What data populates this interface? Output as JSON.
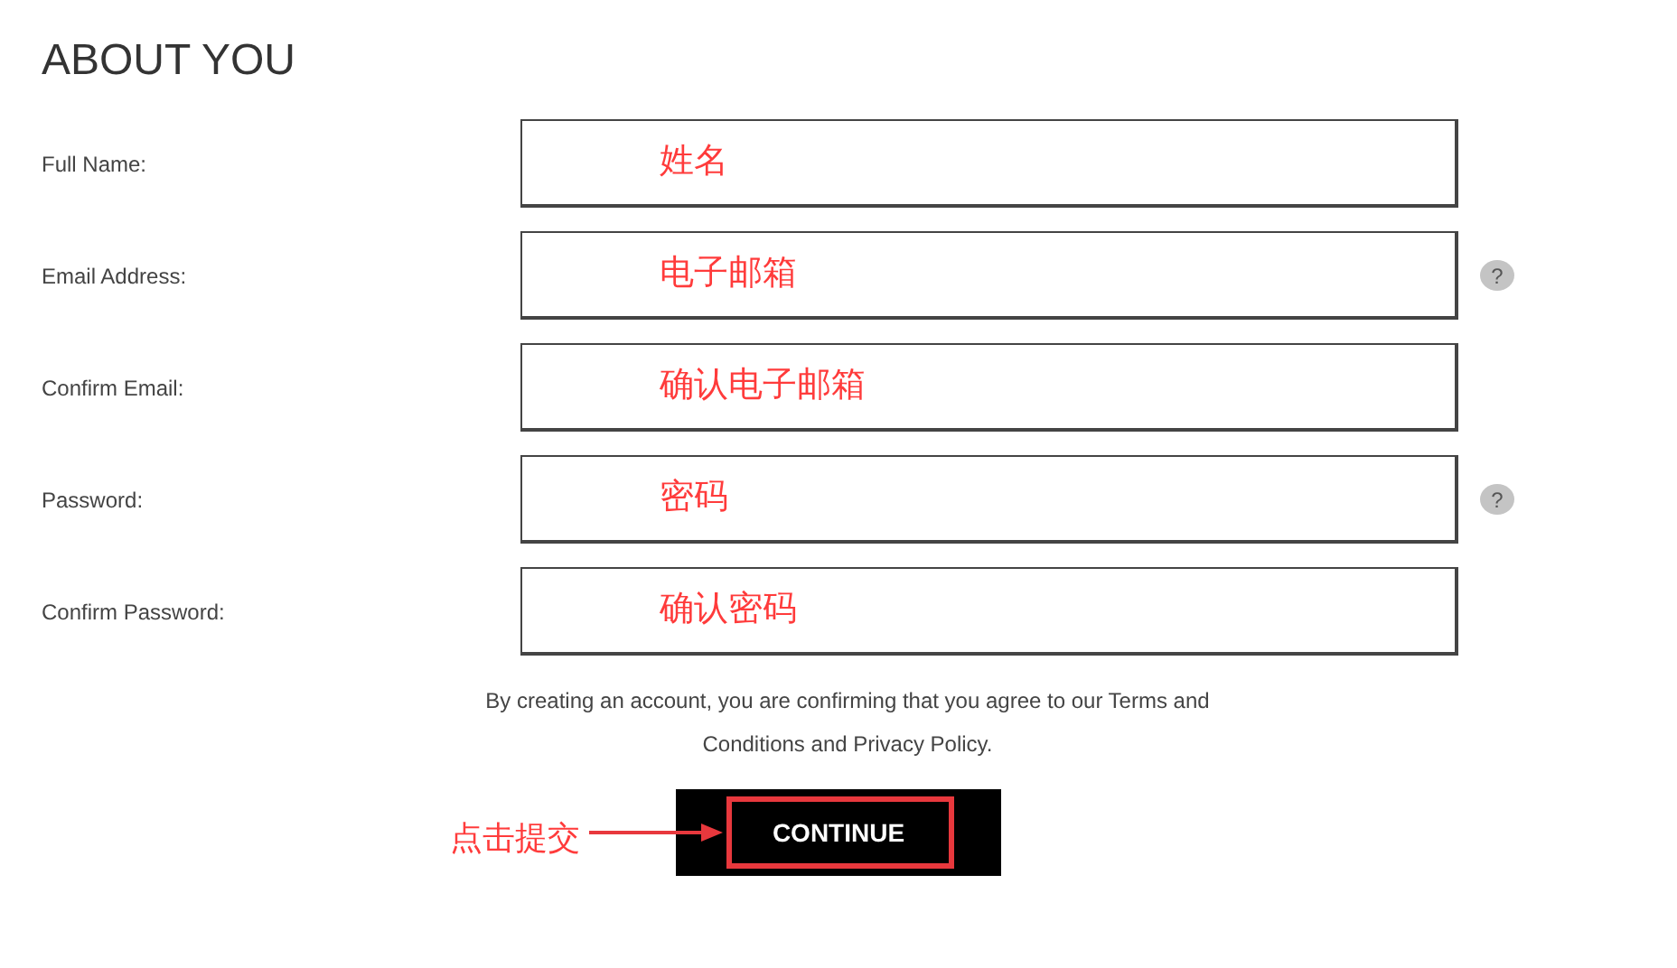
{
  "heading": "ABOUT YOU",
  "fields": [
    {
      "label": "Full Name:",
      "annotation": "姓名",
      "help": false
    },
    {
      "label": "Email Address:",
      "annotation": "电子邮箱",
      "help": true
    },
    {
      "label": "Confirm Email:",
      "annotation": "确认电子邮箱",
      "help": false
    },
    {
      "label": "Password:",
      "annotation": "密码",
      "help": true
    },
    {
      "label": "Confirm Password:",
      "annotation": "确认密码",
      "help": false
    }
  ],
  "help_icon": "?",
  "disclaimer": "By creating an account, you are confirming that you agree to our Terms and Conditions and Privacy Policy.",
  "submit": {
    "label": "CONTINUE",
    "highlighted": true
  },
  "submit_annotation": "点击提交"
}
